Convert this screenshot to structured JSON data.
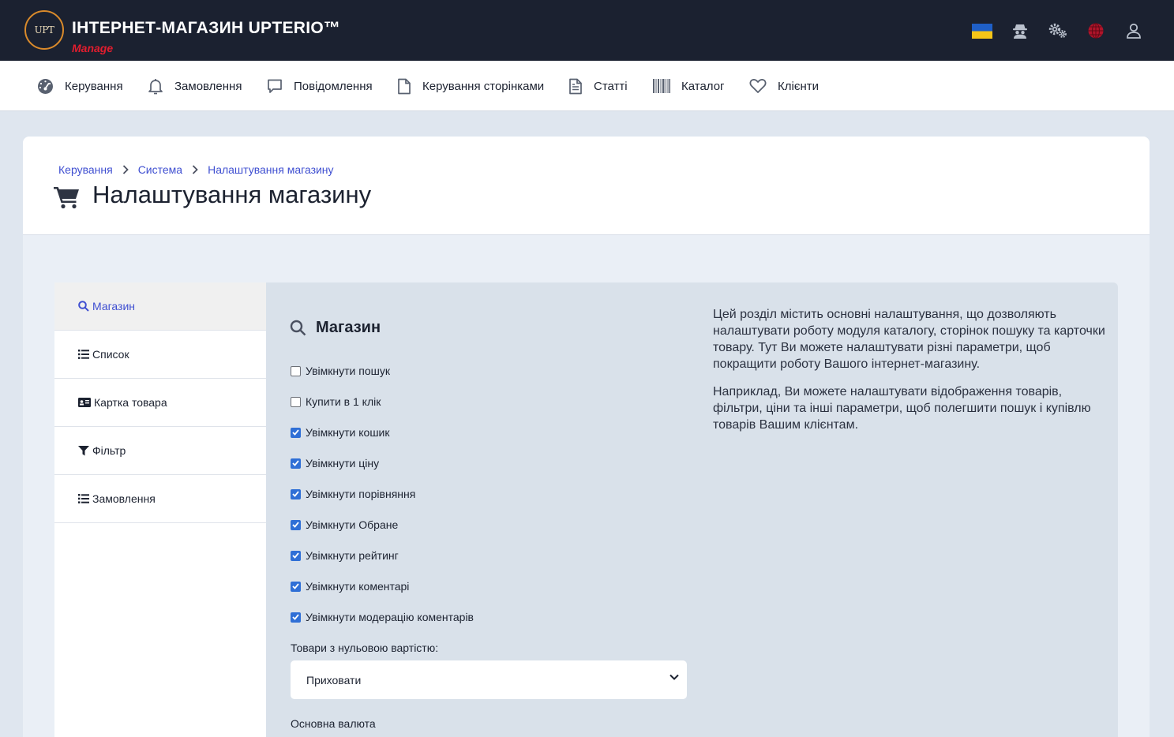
{
  "header": {
    "logo_text": "UPT",
    "brand_title": "ІНТЕРНЕТ-МАГАЗИН UPTERIO™",
    "brand_subtitle": "Manage",
    "icons": [
      "ukraine-flag-icon",
      "incognito-icon",
      "gears-icon",
      "globe-icon",
      "user-icon"
    ],
    "colors": {
      "bg": "#1b2130",
      "accent": "#e11d2e",
      "logo_ring": "#d98a2b"
    }
  },
  "nav": {
    "items": [
      {
        "label": "Керування",
        "icon": "dashboard-icon"
      },
      {
        "label": "Замовлення",
        "icon": "bell-icon"
      },
      {
        "label": "Повідомлення",
        "icon": "message-icon"
      },
      {
        "label": "Керування сторінками",
        "icon": "file-icon"
      },
      {
        "label": "Статті",
        "icon": "file-text-icon"
      },
      {
        "label": "Каталог",
        "icon": "barcode-icon"
      },
      {
        "label": "Клієнти",
        "icon": "heart-icon"
      }
    ]
  },
  "breadcrumb": [
    "Керування",
    "Система",
    "Налаштування магазину"
  ],
  "page_title": "Налаштування магазину",
  "sidebar": {
    "items": [
      {
        "label": "Магазин",
        "icon": "search-icon",
        "active": true
      },
      {
        "label": "Список",
        "icon": "list-icon",
        "active": false
      },
      {
        "label": "Картка товара",
        "icon": "id-card-icon",
        "active": false
      },
      {
        "label": "Фільтр",
        "icon": "filter-icon",
        "active": false
      },
      {
        "label": "Замовлення",
        "icon": "list-icon",
        "active": false
      }
    ]
  },
  "main": {
    "section_title": "Магазин",
    "checkboxes": [
      {
        "label": "Увімкнути пошук",
        "checked": false
      },
      {
        "label": "Купити в 1 клік",
        "checked": false
      },
      {
        "label": "Увімкнути кошик",
        "checked": true
      },
      {
        "label": "Увімкнути ціну",
        "checked": true
      },
      {
        "label": "Увімкнути порівняння",
        "checked": true
      },
      {
        "label": "Увімкнути Обране",
        "checked": true
      },
      {
        "label": "Увімкнути рейтинг",
        "checked": true
      },
      {
        "label": "Увімкнути коментарі",
        "checked": true
      },
      {
        "label": "Увімкнути модерацію коментарів",
        "checked": true
      }
    ],
    "zero_price_label": "Товари з нульовою вартістю:",
    "zero_price_value": "Приховати",
    "currency_label": "Основна валюта",
    "description": [
      "Цей розділ містить основні налаштування, що дозволяють налаштувати роботу модуля каталогу, сторінок пошуку та карточки товару. Тут Ви можете налаштувати різні параметри, щоб покращити роботу Вашого інтернет-магазину.",
      "Наприклад, Ви можете налаштувати відображення товарів, фільтри, ціни та інші параметри, щоб полегшити пошук і купівлю товарів Вашим клієнтам."
    ]
  }
}
